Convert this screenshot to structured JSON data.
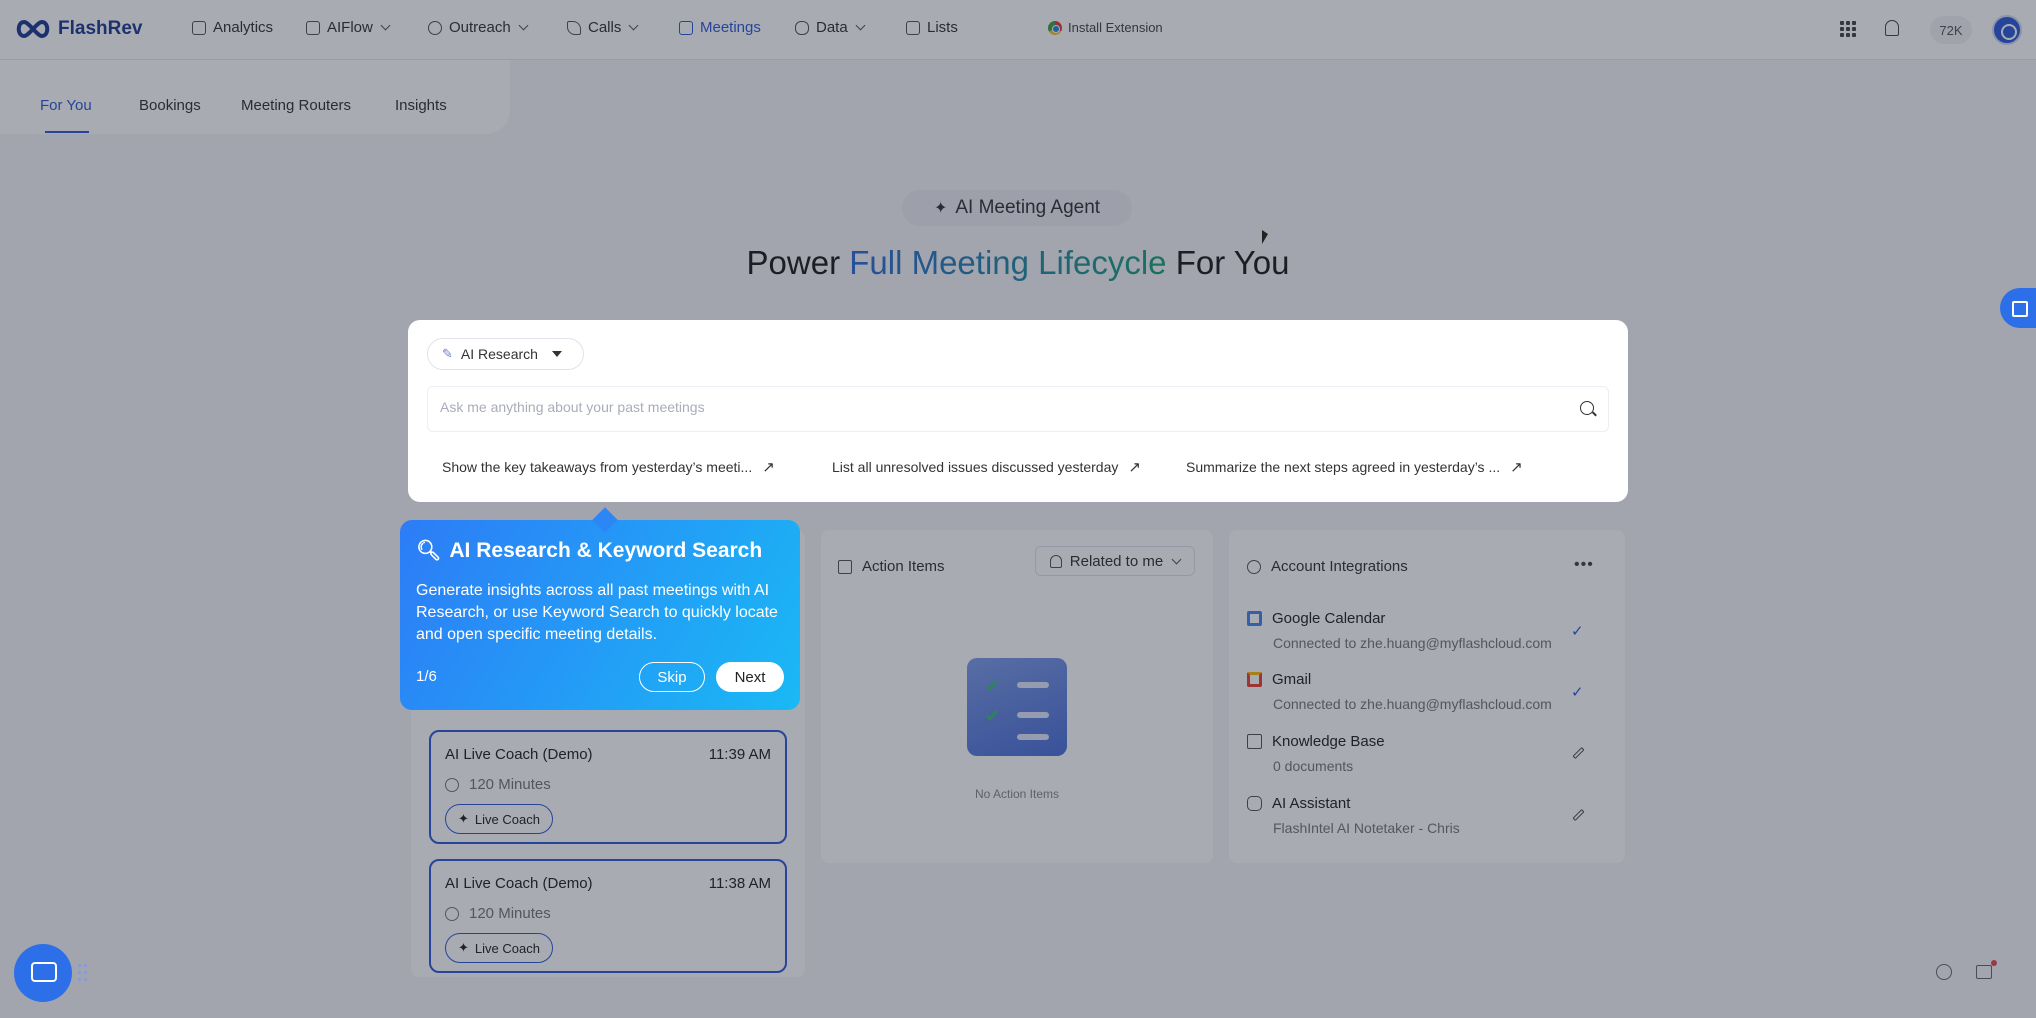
{
  "app": {
    "name": "FlashRev"
  },
  "nav": {
    "items": [
      {
        "label": "Analytics",
        "dropdown": false
      },
      {
        "label": "AIFlow",
        "dropdown": true
      },
      {
        "label": "Outreach",
        "dropdown": true
      },
      {
        "label": "Calls",
        "dropdown": true
      },
      {
        "label": "Meetings",
        "dropdown": false,
        "active": true
      },
      {
        "label": "Data",
        "dropdown": true
      },
      {
        "label": "Lists",
        "dropdown": false
      }
    ],
    "install_extension": "Install Extension",
    "credits": "72K"
  },
  "subtabs": [
    "For You",
    "Bookings",
    "Meeting Routers",
    "Insights"
  ],
  "hero": {
    "badge": "AI Meeting Agent",
    "title_prefix": "Power",
    "title_highlight": "Full Meeting Lifecycle",
    "title_suffix": "For You"
  },
  "search": {
    "mode": "AI Research",
    "placeholder": "Ask me anything about your past meetings",
    "suggestions": [
      "Show the key takeaways from yesterday’s meeti...",
      "List all unresolved issues discussed yesterday",
      "Summarize the next steps agreed in yesterday’s ..."
    ]
  },
  "tour": {
    "title": "AI Research & Keyword Search",
    "body": "Generate insights across all past meetings with AI Research, or use Keyword Search to quickly locate and open specific meeting details.",
    "step": "1/6",
    "skip": "Skip",
    "next": "Next"
  },
  "meetings": [
    {
      "title": "AI Live Coach (Demo)",
      "time": "11:39 AM",
      "duration": "120 Minutes",
      "badge": "Live Coach"
    },
    {
      "title": "AI Live Coach (Demo)",
      "time": "11:38 AM",
      "duration": "120 Minutes",
      "badge": "Live Coach"
    }
  ],
  "action_items": {
    "title": "Action Items",
    "filter": "Related to me",
    "empty": "No Action Items"
  },
  "integrations": {
    "title": "Account Integrations",
    "items": [
      {
        "name": "Google Calendar",
        "detail": "Connected to zhe.huang@myflashcloud.com",
        "status": "connected",
        "icon": "google-calendar-icon",
        "color": "#4285f4"
      },
      {
        "name": "Gmail",
        "detail": "Connected to zhe.huang@myflashcloud.com",
        "status": "connected",
        "icon": "gmail-icon",
        "color": "#ea4335"
      },
      {
        "name": "Knowledge Base",
        "detail": "0 documents",
        "status": "edit",
        "icon": "book-icon",
        "color": "#555555"
      },
      {
        "name": "AI Assistant",
        "detail": "FlashIntel AI Notetaker - Chris",
        "status": "edit",
        "icon": "robot-icon",
        "color": "#555555"
      }
    ]
  },
  "colors": {
    "accent": "#2d5bd8",
    "tour_start": "#2d7cf6",
    "tour_end": "#1ab9f5"
  }
}
